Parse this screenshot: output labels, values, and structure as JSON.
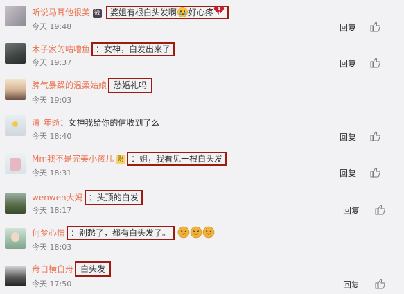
{
  "actions": {
    "reply": "回复",
    "like_icon": "thumbs-up-icon"
  },
  "comments": [
    {
      "user": "听说马耳他很美",
      "badge": "筱",
      "colon": "",
      "text_a": "婆姐有根白头发啊",
      "text_b": "好心疼",
      "time": "今天 19:48"
    },
    {
      "user": "木子家的咕噜鱼",
      "colon": "：",
      "text": "女神，白发出来了",
      "time": "今天 19:37"
    },
    {
      "user": "脾气暴躁的温柔姑娘",
      "colon": "",
      "text": "愁婚礼吗",
      "time": "今天 19:03"
    },
    {
      "user": "清-年逝",
      "colon": "：",
      "text": "女神我给你的信收到了么",
      "time": "今天 18:40"
    },
    {
      "user": "Mm我不是完美小孩儿",
      "badge": "财",
      "colon": "：",
      "text": "姐，我看见一根白头发",
      "time": "今天 18:31"
    },
    {
      "user": "wenwen大妈",
      "colon": "：",
      "text": "头顶的白发",
      "time": "今天 18:17"
    },
    {
      "user": "何梦心情",
      "colon": "：",
      "text": "别愁了，都有白头发了。",
      "time": "今天 18:03"
    },
    {
      "user": "舟自横自舟",
      "colon": "",
      "text": "白头发",
      "time": "今天 17:50"
    }
  ]
}
